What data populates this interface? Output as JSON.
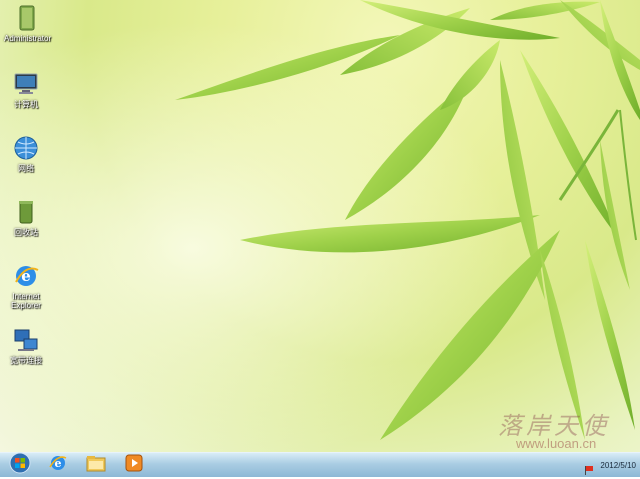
{
  "desktop": {
    "icons": [
      {
        "label": "Administrator",
        "icon": "user-folder-icon"
      },
      {
        "label": "计算机",
        "icon": "computer-icon"
      },
      {
        "label": "网络",
        "icon": "network-icon"
      },
      {
        "label": "回收站",
        "icon": "recycle-bin-icon"
      },
      {
        "label": "Internet\nExplorer",
        "icon": "internet-explorer-icon"
      },
      {
        "label": "宽带连接",
        "icon": "broadband-connection-icon"
      }
    ],
    "watermark_text": "落岸天使",
    "watermark_url": "www.luoan.cn"
  },
  "taskbar": {
    "pinned": [
      "start-orb-icon",
      "internet-explorer-icon",
      "windows-explorer-icon",
      "media-player-icon"
    ],
    "clock": {
      "time": "",
      "date": "2012/5/10"
    }
  },
  "colors": {
    "taskbar": "#aacde3",
    "leaf": "#9fd14a",
    "background": "#e7f09a"
  }
}
